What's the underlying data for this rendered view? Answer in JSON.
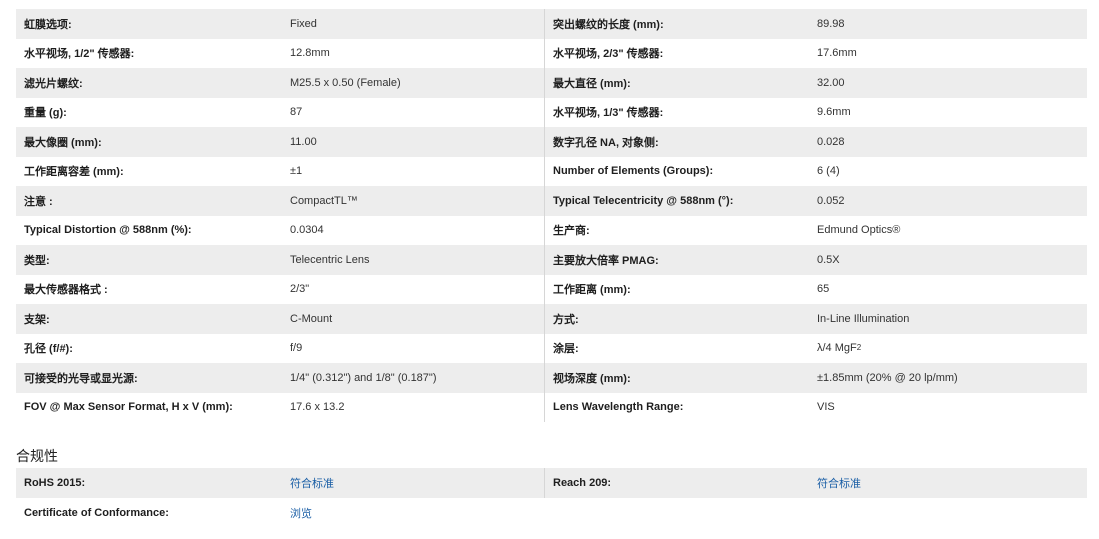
{
  "specs": {
    "rows": [
      {
        "l1": "虹膜选项:",
        "v1": "Fixed",
        "l2": "突出螺纹的长度 (mm):",
        "v2": "89.98"
      },
      {
        "l1": "水平视场, 1/2\" 传感器:",
        "v1": "12.8mm",
        "l2": "水平视场, 2/3\" 传感器:",
        "v2": "17.6mm"
      },
      {
        "l1": "滤光片螺纹:",
        "v1": "M25.5 x 0.50 (Female)",
        "l2": "最大直径 (mm):",
        "v2": "32.00"
      },
      {
        "l1": "重量 (g):",
        "v1": "87",
        "l2": "水平视场, 1/3\" 传感器:",
        "v2": "9.6mm"
      },
      {
        "l1": "最大像圈 (mm):",
        "v1": "11.00",
        "l2": "数字孔径 NA, 对象侧:",
        "v2": "0.028"
      },
      {
        "l1": "工作距离容差 (mm):",
        "v1": "±1",
        "l2": "Number of Elements (Groups):",
        "v2": "6 (4)"
      },
      {
        "l1": "注意 :",
        "v1": "CompactTL™",
        "l2": "Typical Telecentricity @ 588nm (°):",
        "v2": "0.052"
      },
      {
        "l1": "Typical Distortion @ 588nm (%):",
        "v1": "0.0304",
        "l2": "生产商:",
        "v2": "Edmund Optics®"
      },
      {
        "l1": "类型:",
        "v1": "Telecentric Lens",
        "l2": "主要放大倍率 PMAG:",
        "v2": "0.5X"
      },
      {
        "l1": "最大传感器格式 :",
        "v1": "2/3\"",
        "l2": "工作距离 (mm):",
        "v2": "65"
      },
      {
        "l1": "支架:",
        "v1": "C-Mount",
        "l2": "方式:",
        "v2": "In-Line Illumination"
      },
      {
        "l1": "孔径 (f/#):",
        "v1": "f/9",
        "l2": "涂层:",
        "v2": "λ/4 MgF",
        "v2_sub": "2"
      },
      {
        "l1": "可接受的光导或显光源:",
        "v1": "1/4\" (0.312\") and 1/8\" (0.187\")",
        "l2": "视场深度 (mm):",
        "v2": "±1.85mm (20% @ 20 lp/mm)"
      },
      {
        "l1": "FOV @ Max Sensor Format, H x V (mm):",
        "v1": "17.6 x 13.2",
        "l2": "Lens Wavelength Range:",
        "v2": "VIS"
      }
    ]
  },
  "compliance": {
    "title": "合规性",
    "rows": [
      {
        "l1": "RoHS 2015:",
        "v1": "符合标准",
        "l2": "Reach 209:",
        "v2": "符合标准"
      },
      {
        "l1": "Certificate of Conformance:",
        "v1": "浏览"
      }
    ]
  }
}
